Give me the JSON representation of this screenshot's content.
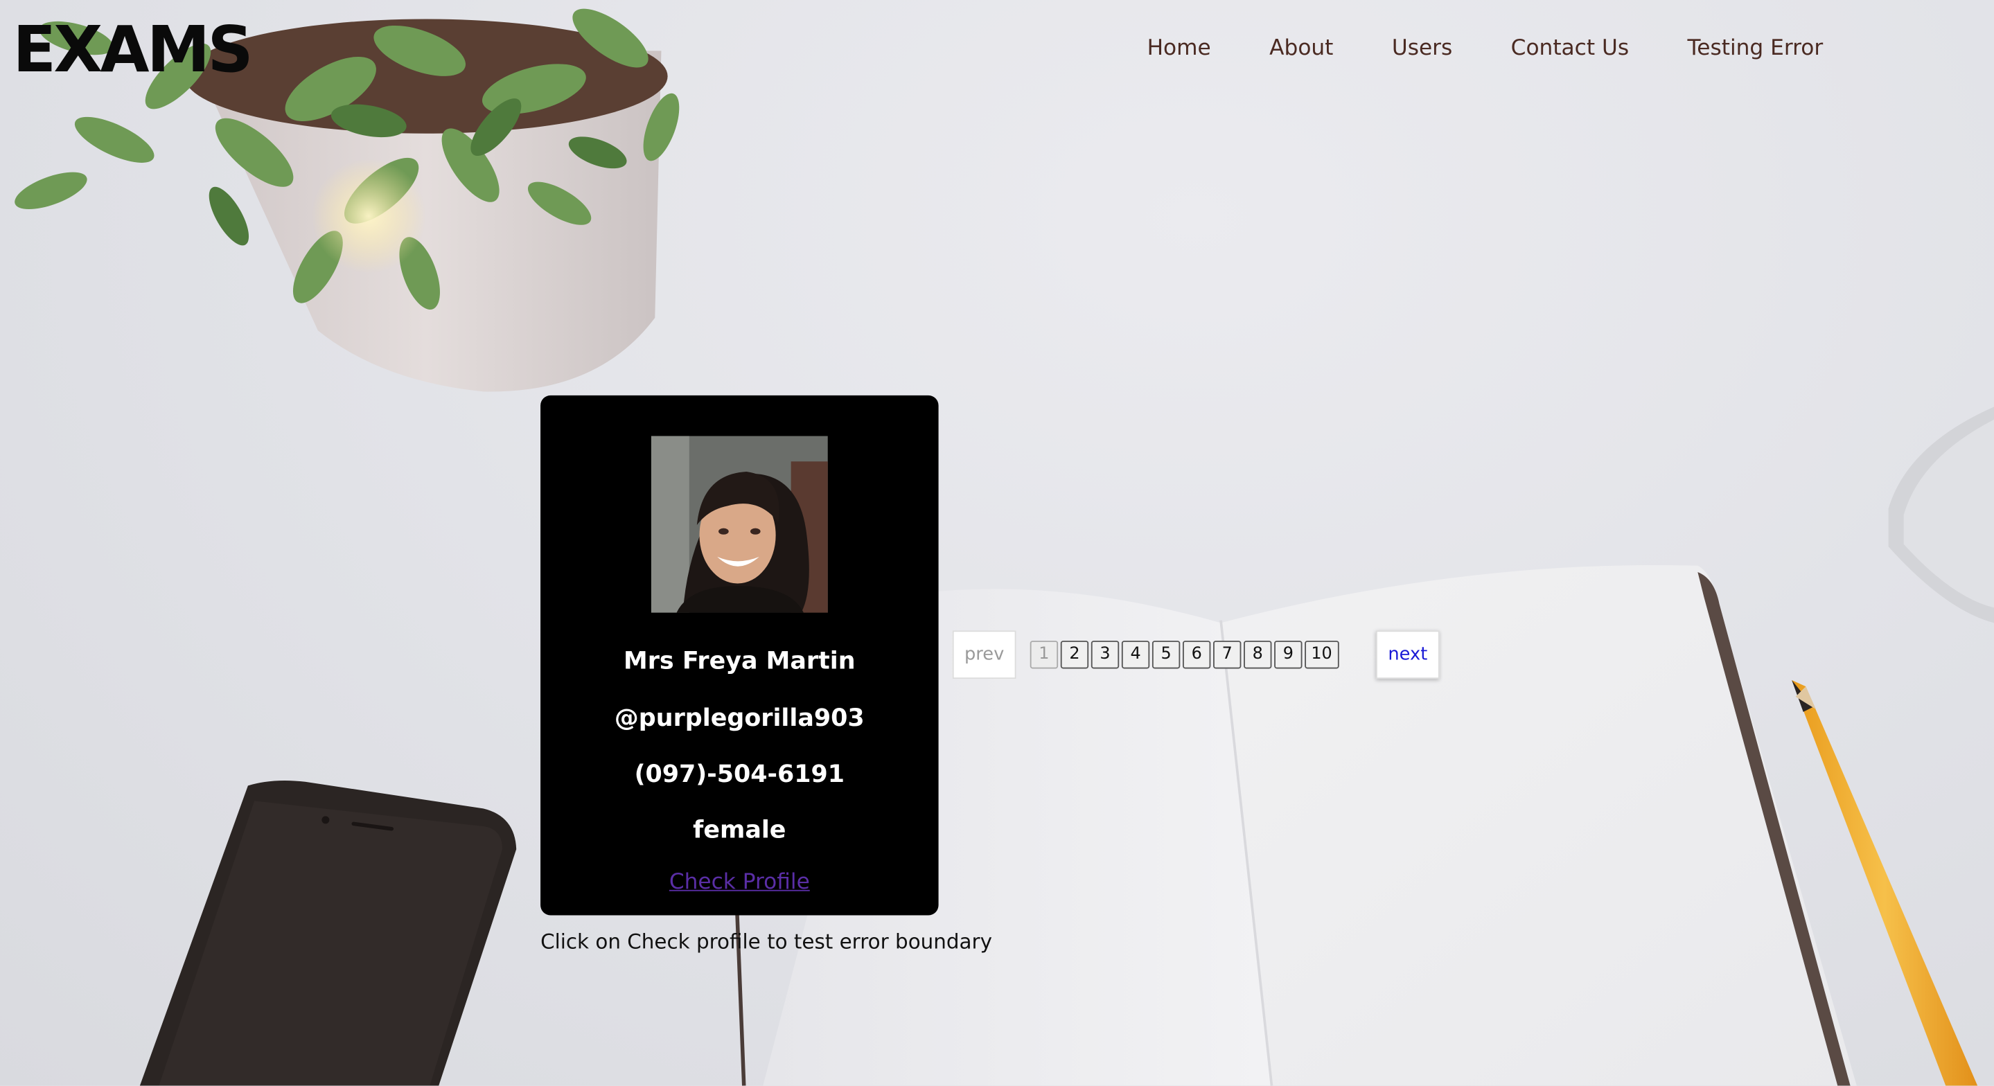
{
  "brand": {
    "title": "EXAMS"
  },
  "nav": {
    "items": [
      {
        "label": "Home"
      },
      {
        "label": "About"
      },
      {
        "label": "Users"
      },
      {
        "label": "Contact Us"
      },
      {
        "label": "Testing Error"
      }
    ]
  },
  "user": {
    "name": "Mrs Freya Martin",
    "username": "@purplegorilla903",
    "phone": "(097)-504-6191",
    "gender": "female",
    "link_label": "Check Profile",
    "avatar_icon": "user-photo"
  },
  "hint": "Click on Check profile to test error boundary",
  "pagination": {
    "prev_label": "prev",
    "next_label": "next",
    "current_page": 1,
    "pages": [
      "1",
      "2",
      "3",
      "4",
      "5",
      "6",
      "7",
      "8",
      "9",
      "10"
    ]
  },
  "colors": {
    "nav_text": "#4a2a22",
    "card_bg": "#000000",
    "link": "#5a2ea6",
    "next_text": "#1a1ad6"
  }
}
